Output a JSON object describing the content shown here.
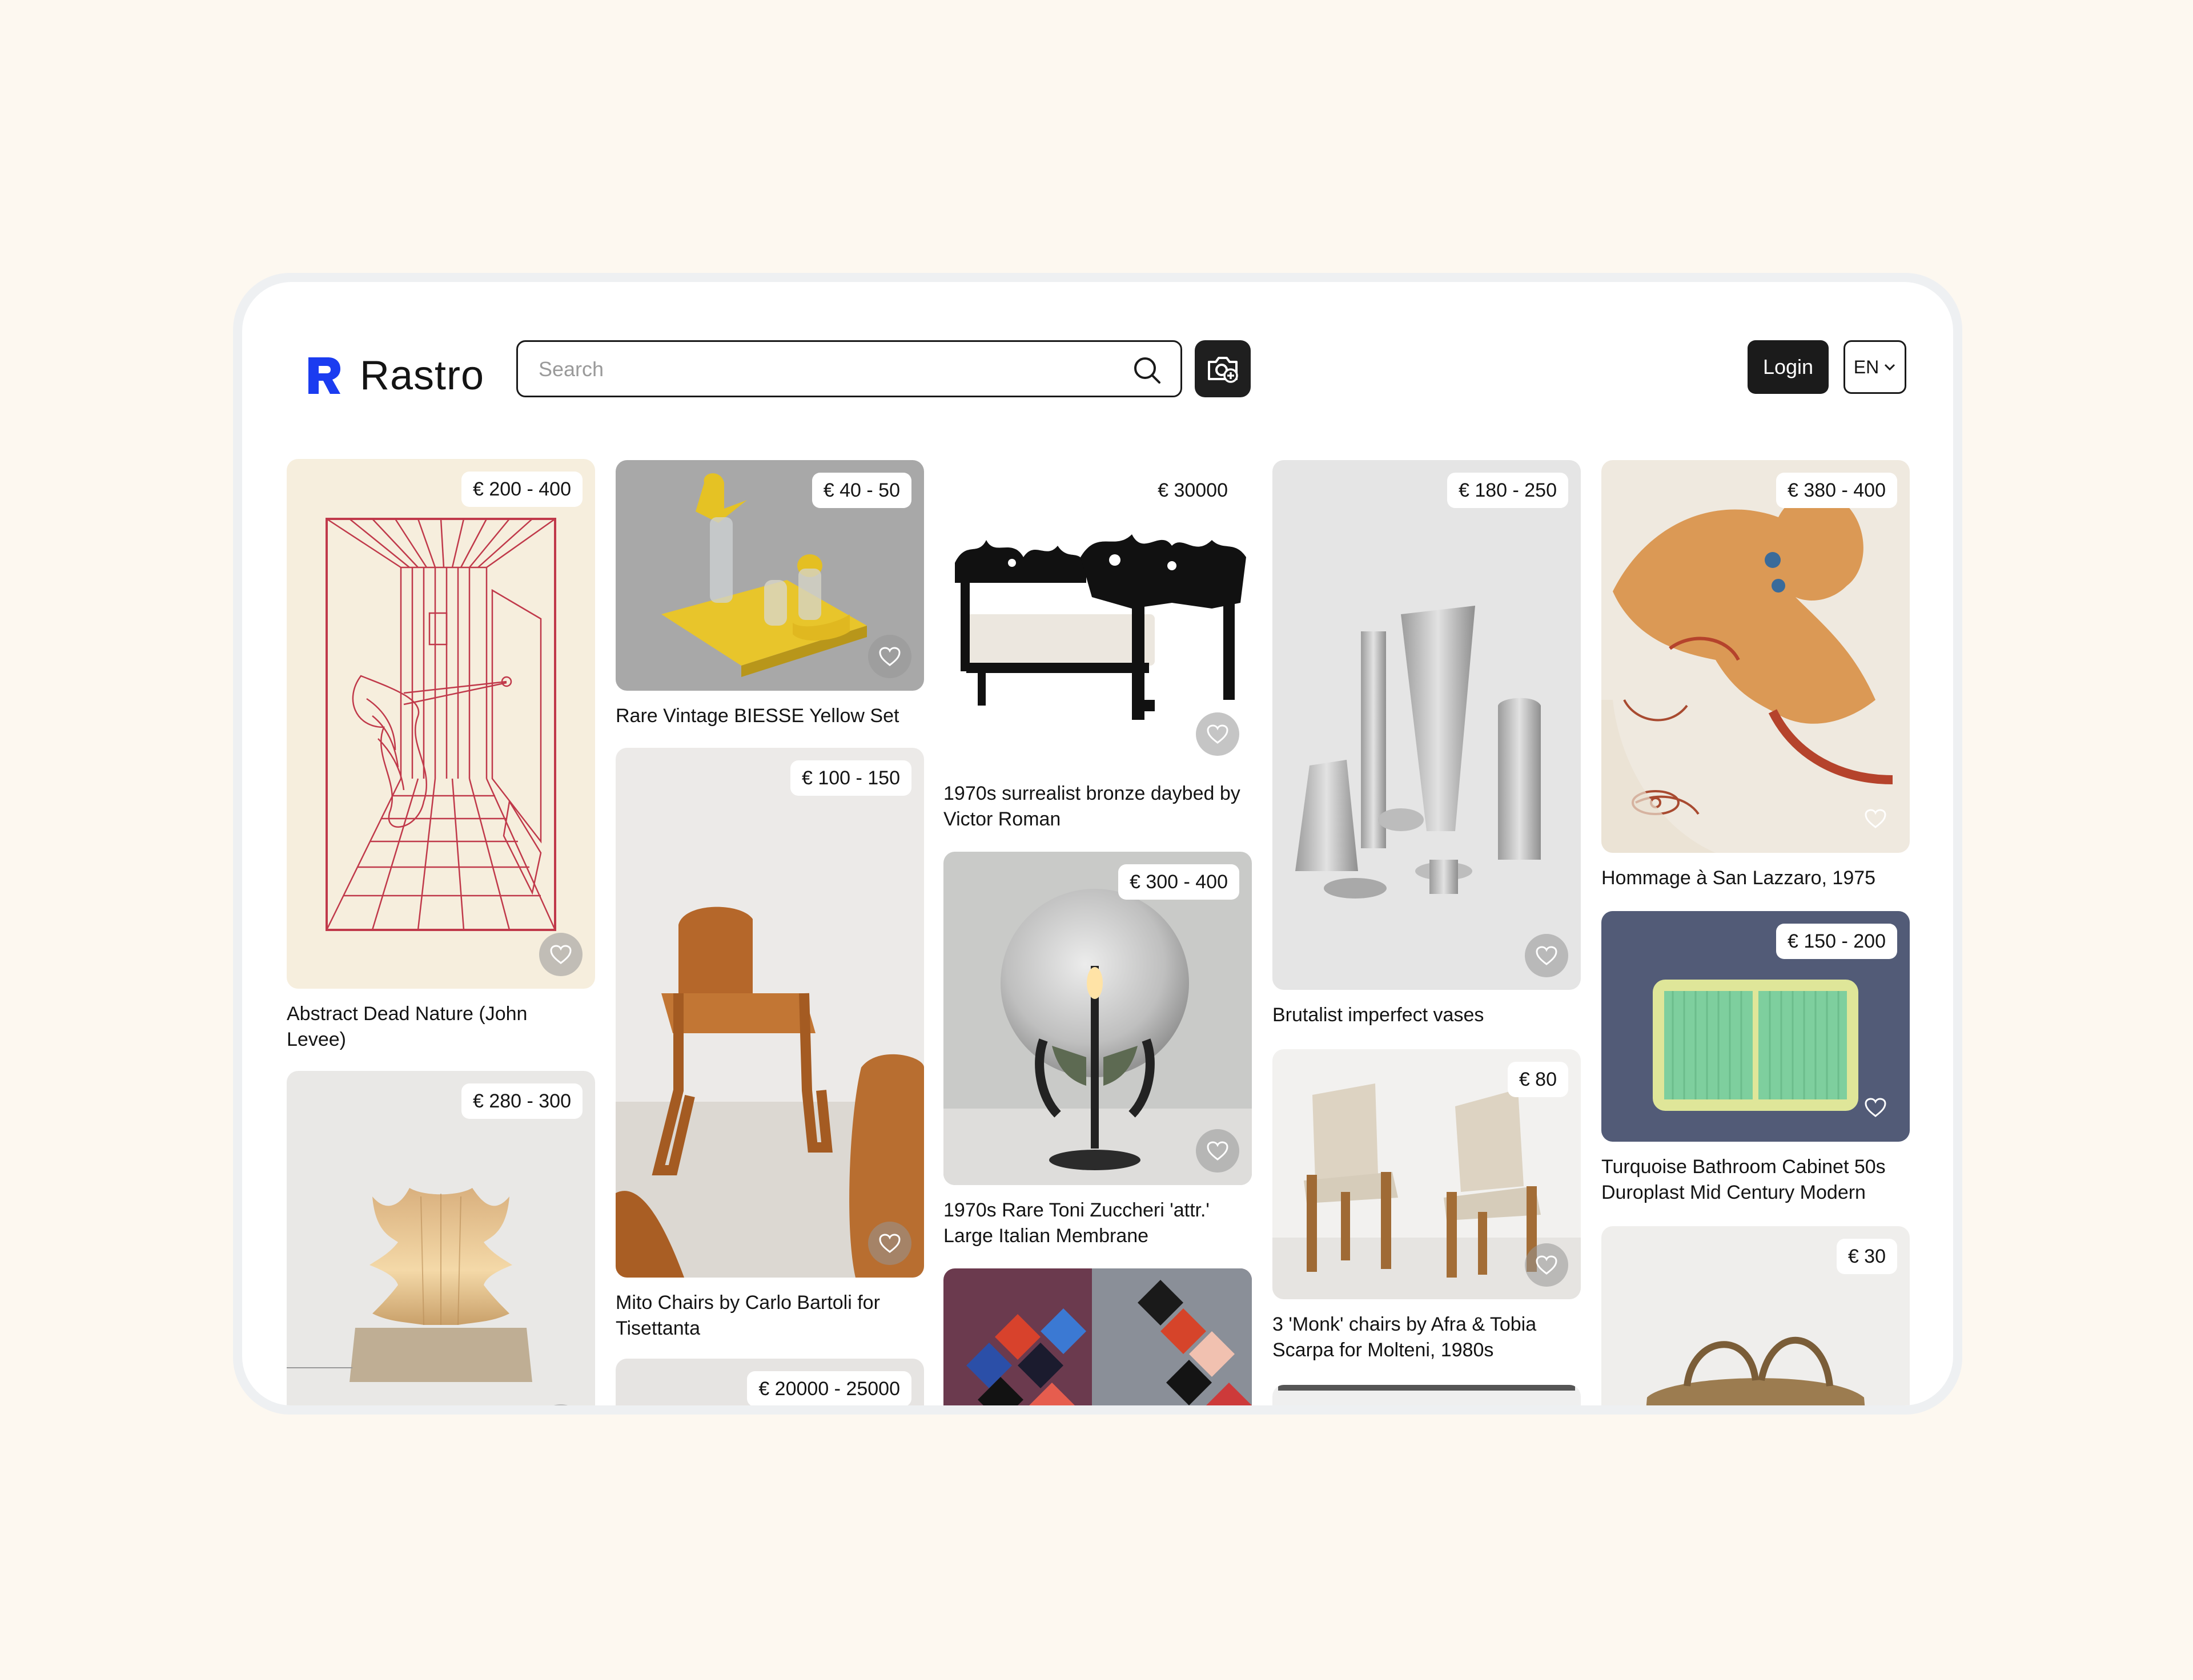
{
  "brand": {
    "name": "Rastro",
    "color": "#1b3cf0"
  },
  "search": {
    "placeholder": "Search",
    "value": ""
  },
  "header": {
    "camera_icon": "camera-plus-icon",
    "login_label": "Login",
    "language": "EN"
  },
  "products": [
    {
      "id": "p1",
      "price": "€ 200 - 400",
      "title": "Abstract Dead Nature (John Levee)"
    },
    {
      "id": "p2",
      "price": "€ 280 - 300",
      "title": ""
    },
    {
      "id": "p3",
      "price": "€ 40 - 50",
      "title": "Rare Vintage BIESSE Yellow  Set"
    },
    {
      "id": "p4",
      "price": "€ 100 - 150",
      "title": "Mito Chairs by Carlo Bartoli for Tisettanta"
    },
    {
      "id": "p5",
      "price": "€ 20000 - 25000",
      "title": ""
    },
    {
      "id": "p6",
      "price": "€ 30000",
      "title": "1970s surrealist bronze daybed by Victor Roman"
    },
    {
      "id": "p7",
      "price": "€ 300 - 400",
      "title": "1970s Rare Toni Zuccheri 'attr.' Large Italian Membrane"
    },
    {
      "id": "p8",
      "price": "",
      "title": ""
    },
    {
      "id": "p9",
      "price": "€ 180 - 250",
      "title": "Brutalist imperfect vases"
    },
    {
      "id": "p10",
      "price": "€ 80",
      "title": "3 'Monk' chairs by Afra & Tobia Scarpa for Molteni, 1980s"
    },
    {
      "id": "p11",
      "price": "€ 380 - 400",
      "title": "Hommage à San Lazzaro, 1975"
    },
    {
      "id": "p12",
      "price": "€ 150 - 200",
      "title": "Turquoise Bathroom Cabinet 50s Duroplast Mid Century Modern"
    },
    {
      "id": "p13",
      "price": "€ 30",
      "title": ""
    }
  ]
}
